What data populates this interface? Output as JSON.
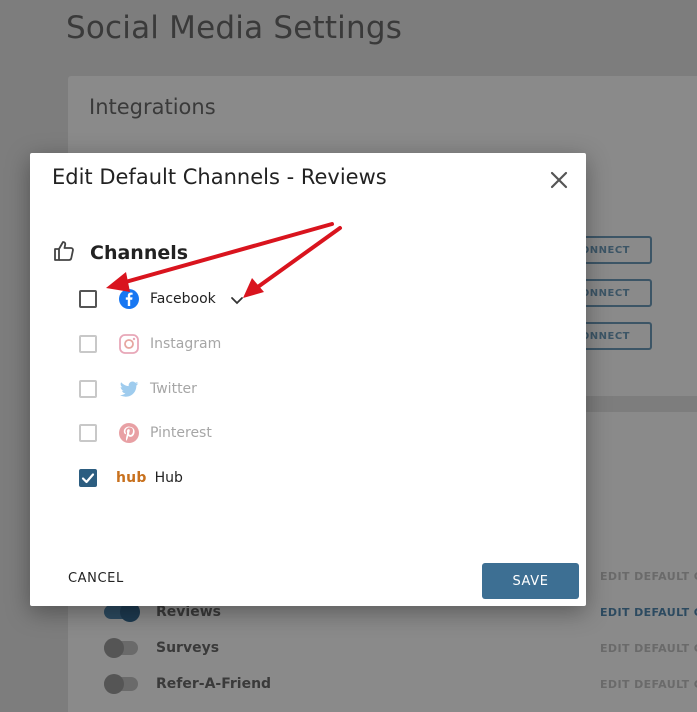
{
  "page": {
    "title": "Social Media Settings",
    "integrations_title": "Integrations",
    "connect_label": "CONNECT",
    "feature_rows": [
      {
        "label": "Reviews",
        "on": true
      },
      {
        "label": "Surveys",
        "on": false
      },
      {
        "label": "Refer-A-Friend",
        "on": false
      }
    ],
    "edit_label": "EDIT DEFAULT CHANNELS"
  },
  "modal": {
    "title": "Edit Default Channels - Reviews",
    "section_title": "Channels",
    "channels": [
      {
        "label": "Facebook",
        "checked": false,
        "enabled": true,
        "icon": "facebook-icon"
      },
      {
        "label": "Instagram",
        "checked": false,
        "enabled": false,
        "icon": "instagram-icon"
      },
      {
        "label": "Twitter",
        "checked": false,
        "enabled": false,
        "icon": "twitter-icon"
      },
      {
        "label": "Pinterest",
        "checked": false,
        "enabled": false,
        "icon": "pinterest-icon"
      },
      {
        "label": "Hub",
        "checked": true,
        "enabled": true,
        "icon": "hub-logo",
        "logo_text": "hub"
      }
    ],
    "cancel_label": "CANCEL",
    "save_label": "SAVE"
  },
  "colors": {
    "primary": "#3d6f93",
    "facebook": "#1877f2",
    "hub": "#c8711e",
    "annotation_arrow": "#d9141e"
  }
}
